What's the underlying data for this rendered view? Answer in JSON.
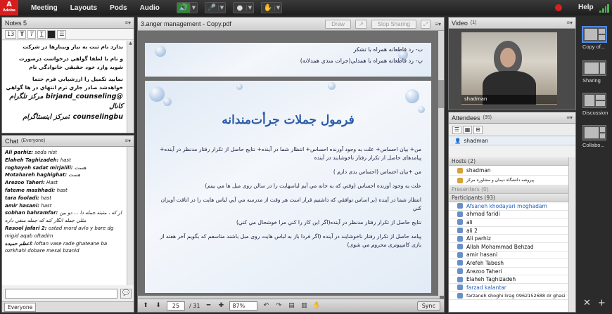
{
  "topbar": {
    "logo": "Adobe",
    "menus": [
      "Meeting",
      "Layouts",
      "Pods",
      "Audio"
    ],
    "help": "Help"
  },
  "notes": {
    "title": "Notes 5",
    "font_size": "13",
    "lines": [
      "بدارد نام ثبت به نیاز وبینارها در شرکت",
      "و نام با لطفا گواهي درخواست درصورت",
      "شوید وارد خود حقیقي خانوادگي نام",
      "نمایید تکمیل را ارزشیابي فرم حتما",
      "خواهدشد صادر جاري ترم انتهاي در ها گواهي"
    ],
    "big_lines": [
      "@birjand_counseling مرکز تلگرام کانال",
      "counselingbu :مرکز اینستاگرام"
    ]
  },
  "chat": {
    "title": "Chat",
    "audience": "(Everyone)",
    "messages": [
      {
        "name": "Ali parhiz:",
        "text": "seda nist"
      },
      {
        "name": "Elaheh Taghizadeh:",
        "text": "hast"
      },
      {
        "name": "roghayeh sadat mirjalili:",
        "text": "هست"
      },
      {
        "name": "Motahareh haghighat:",
        "text": "هست"
      },
      {
        "name": "Arezoo Taheri:",
        "text": "Hast"
      },
      {
        "name": "fateme mashhadi:",
        "text": "hast"
      },
      {
        "name": "tara fooladi:",
        "text": "hast"
      },
      {
        "name": "amir hasani:",
        "text": "hast"
      },
      {
        "name": "sobhan bahramfar:",
        "text": "از که ، مثبته جمله دا ... دو بین مثلي جمله انگار کنه که جمله منفي داره"
      },
      {
        "name": "Rasool jafari 2:",
        "text": "ostad mord avlo y bare dg migid aqab oftadim"
      },
      {
        "name": "اعظم حميده:",
        "text": "loftan vase rade ghateane ba ozrkhahi dobare mesal bzanid"
      }
    ],
    "footer_tab": "Everyone"
  },
  "share": {
    "title": "3.anger management - Copy.pdf",
    "draw_label": "Draw",
    "stop_label": "Stop Sharing",
    "slide_top_lines": [
      "ب- رد قاطعانه همراه با تشکر",
      "پ- رد قاطعانه همراه با همدلي(جرات مندي همدلانه)"
    ],
    "slide_title": "فرمول جملات جرأت‌مندانه",
    "slide_lines": [
      "من+ بیان احساس+ علت به وجود آورنده احساس+ انتظار شما در آینده+ نتایج حاصل از تکرار رفتار مدنظر در آینده+ پیامدهای حاصل از تکرار رفتار ناخوشایند در آینده",
      "من +بیان احساس (احساس بدی دارم )",
      "علت به وجود آورنده احساس (وقتي که به خانه مي آیم لباسهایت را در سالن روی مبل ها مي بینم)",
      "انتظار شما در آینده (بر اساس توافقي که داشتیم قرار است هر وقت  از مدرسه مي آیي لباس هایت را در اتاقت آویزان کني",
      "نتایج حاصل از تکرار رفتار مدنظر در آینده(اگر این کار را کني مرا خوشحال مي کني)",
      "پیامد حاصل از تکرار رفتار ناخوشایند در آینده (اگر فردا باز به لباس هایت روی مبل باشند متاسفم که بگویم آخر هفته از بازی کامپیوتری محروم مي شوی)"
    ],
    "page_current": "25",
    "page_total": "/ 31",
    "zoom": "87%",
    "sync_label": "Sync"
  },
  "video": {
    "title": "Video",
    "count": "(1)",
    "name": "shadman"
  },
  "attendees": {
    "title": "Attendees",
    "count": "(95)",
    "me": "shadman",
    "hosts_label": "Hosts (2)",
    "hosts": [
      "shadman",
      "پیروشه دانشگاه دیمان و مشاوره مرکز"
    ],
    "presenters_label": "Presenters (0)",
    "participants_label": "Participants (93)",
    "participants": [
      "Afsaneh khodayari moghadam",
      "ahmad faridi",
      "ali",
      "ali 2",
      "Ali parhiz",
      "Allah Mohammad Behzad",
      "amir hasani",
      "Arefeh Tabesh",
      "Arezoo Taheri",
      "Elaheh Taghizadeh",
      "farzad kalantar",
      "farzaneh shoghi lirag 0962152688 dr ghasi"
    ]
  },
  "layouts": {
    "items": [
      "Copy of...",
      "Sharing",
      "Discussion",
      "Collabo..."
    ]
  }
}
